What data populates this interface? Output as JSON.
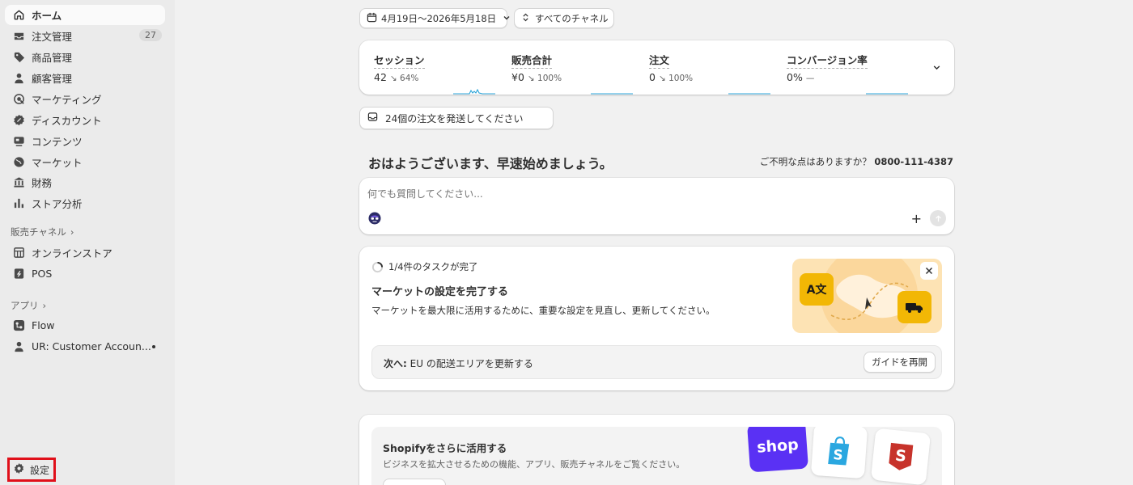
{
  "sidebar": {
    "items": [
      {
        "label": "ホーム",
        "icon": "home-icon"
      },
      {
        "label": "注文管理",
        "icon": "inbox-icon",
        "badge": "27"
      },
      {
        "label": "商品管理",
        "icon": "tag-icon"
      },
      {
        "label": "顧客管理",
        "icon": "person-icon"
      },
      {
        "label": "マーケティング",
        "icon": "target-icon"
      },
      {
        "label": "ディスカウント",
        "icon": "discount-icon"
      },
      {
        "label": "コンテンツ",
        "icon": "content-icon"
      },
      {
        "label": "マーケット",
        "icon": "globe-icon"
      },
      {
        "label": "財務",
        "icon": "bank-icon"
      },
      {
        "label": "ストア分析",
        "icon": "bar-chart-icon"
      }
    ],
    "sales_channels_heading": "販売チャネル",
    "channels": [
      {
        "label": "オンラインストア",
        "icon": "store-icon"
      },
      {
        "label": "POS",
        "icon": "pos-icon"
      }
    ],
    "apps_heading": "アプリ",
    "apps": [
      {
        "label": "Flow",
        "icon": "flow-icon"
      },
      {
        "label": "UR: Customer Accoun...",
        "icon": "person-icon"
      }
    ],
    "settings_label": "設定"
  },
  "toolbar": {
    "date_range": "4月19日〜2026年5月18日",
    "channel_filter": "すべてのチャネル"
  },
  "metrics": [
    {
      "name": "セッション",
      "value": "42",
      "change": "↘ 64%"
    },
    {
      "name": "販売合計",
      "value": "¥0",
      "change": "↘ 100%"
    },
    {
      "name": "注文",
      "value": "0",
      "change": "↘ 100%"
    },
    {
      "name": "コンバージョン率",
      "value": "0%",
      "change": "—"
    }
  ],
  "orders_notice": "24個の注文を発送してください",
  "greeting": "おはようございます、早速始めましょう。",
  "help": {
    "text": "ご不明な点はありますか？",
    "phone": "0800-111-4387"
  },
  "assistant": {
    "placeholder": "何でも質問してください..."
  },
  "task_card": {
    "progress": "1/4件のタスクが完了",
    "progress_fraction": 0.25,
    "title": "マーケットの設定を完了する",
    "description": "マーケットを最大限に活用するために、重要な設定を見直し、更新してください。",
    "next_prefix": "次へ:",
    "next_text": "EU の配送エリアを更新する",
    "guide_button": "ガイドを再開"
  },
  "shopify_card": {
    "title": "Shopifyをさらに活用する",
    "description": "ビジネスを拡大させるための機能、アプリ、販売チャネルをご覧ください。",
    "shop_logo": "shop"
  },
  "colors": {
    "accent": "#29a3d8",
    "sidebar_bg": "#ebebeb",
    "page_bg": "#f1f1f1",
    "highlight": "#e0101a",
    "shop_purple": "#5a31f4"
  }
}
